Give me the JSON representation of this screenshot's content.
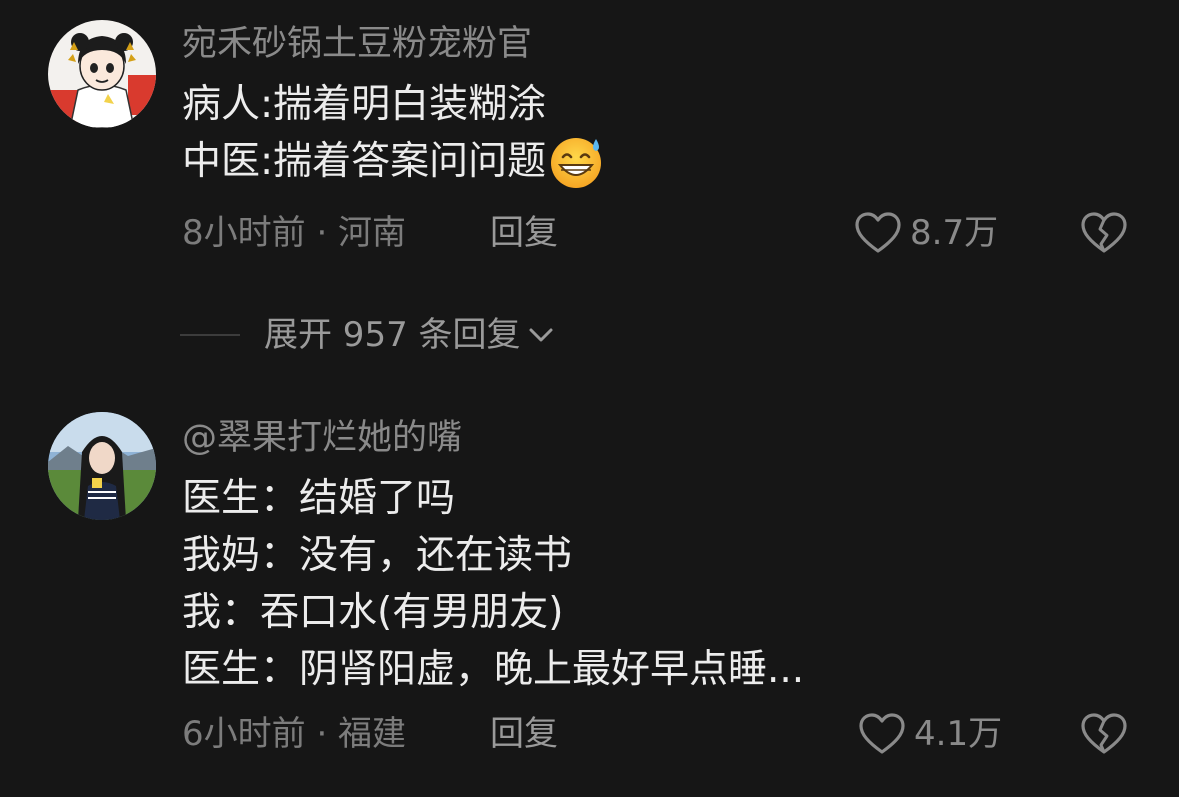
{
  "comments": [
    {
      "username": "宛禾砂锅土豆粉宠粉官",
      "lines": [
        "病人:揣着明白装糊涂",
        "中医:揣着答案问问题"
      ],
      "emoji": "grinning-sweat-emoji",
      "meta": "8小时前 · 河南",
      "reply_label": "回复",
      "likes": "8.7万"
    },
    {
      "username": "@翠果打烂她的嘴",
      "lines": [
        "医生：结婚了吗",
        "我妈：没有，还在读书",
        "我：吞口水(有男朋友)",
        "医生：阴肾阳虚，晚上最好早点睡..."
      ],
      "meta": "6小时前 · 福建",
      "reply_label": "回复",
      "likes": "4.1万"
    }
  ],
  "expand_replies": {
    "label": "展开 957 条回复"
  },
  "icons": {
    "like": "heart-outline-icon",
    "dislike": "broken-heart-icon",
    "expand": "chevron-down-icon"
  },
  "colors": {
    "background": "#161616",
    "username": "#8a8a8a",
    "body_text": "#ececec",
    "meta_text": "#7c7c7c"
  }
}
